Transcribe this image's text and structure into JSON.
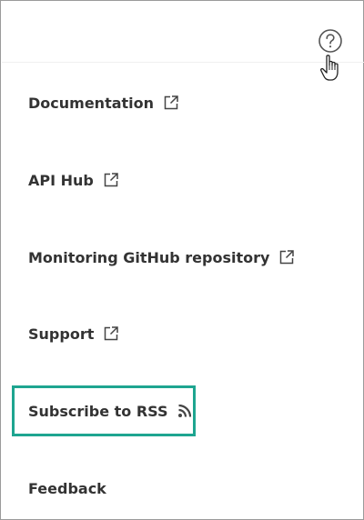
{
  "menu": {
    "items": [
      {
        "label": "Documentation",
        "icon": "external-link-icon"
      },
      {
        "label": "API Hub",
        "icon": "external-link-icon"
      },
      {
        "label": "Monitoring GitHub repository",
        "icon": "external-link-icon"
      },
      {
        "label": "Support",
        "icon": "external-link-icon"
      },
      {
        "label": "Subscribe to RSS",
        "icon": "rss-icon"
      },
      {
        "label": "Feedback",
        "icon": ""
      }
    ]
  },
  "header": {
    "help_icon": "question-circle-icon",
    "cursor_icon": "pointer-hand-icon"
  },
  "colors": {
    "highlight": "#1ea590",
    "text": "#333333",
    "icon": "#444444"
  }
}
